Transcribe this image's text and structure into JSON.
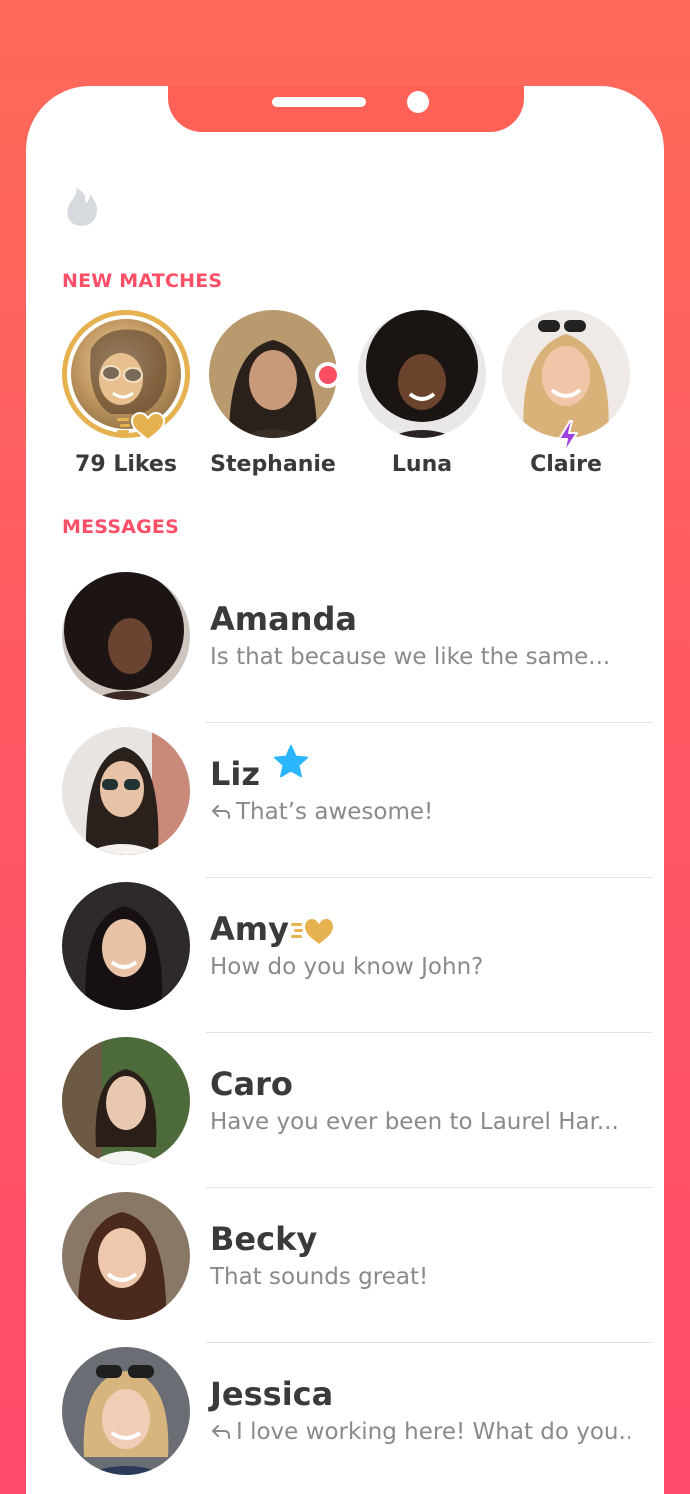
{
  "header": {
    "logo_icon": "flame-icon"
  },
  "new_matches": {
    "title": "NEW MATCHES",
    "items": [
      {
        "name": "79 Likes",
        "badge": "gold-heart-icon"
      },
      {
        "name": "Stephanie",
        "badge": "online-dot"
      },
      {
        "name": "Luna"
      },
      {
        "name": "Claire",
        "badge": "bolt-icon"
      }
    ]
  },
  "messages": {
    "title": "MESSAGES",
    "items": [
      {
        "name": "Amanda",
        "text": "Is that because we like the same..."
      },
      {
        "name": "Liz",
        "text": "That’s awesome!",
        "replied": true,
        "badge": "star-icon"
      },
      {
        "name": "Amy",
        "text": "How do you know John?",
        "badge": "gold-heart-icon"
      },
      {
        "name": "Caro",
        "text": "Have you ever been to Laurel Har..."
      },
      {
        "name": "Becky",
        "text": "That sounds great!"
      },
      {
        "name": "Jessica",
        "text": "I love working here! What do you...",
        "replied": true
      }
    ]
  },
  "colors": {
    "accent": "#fd5068",
    "gold": "#e5b24f",
    "star": "#2bb6ff",
    "bolt": "#a040e0"
  }
}
